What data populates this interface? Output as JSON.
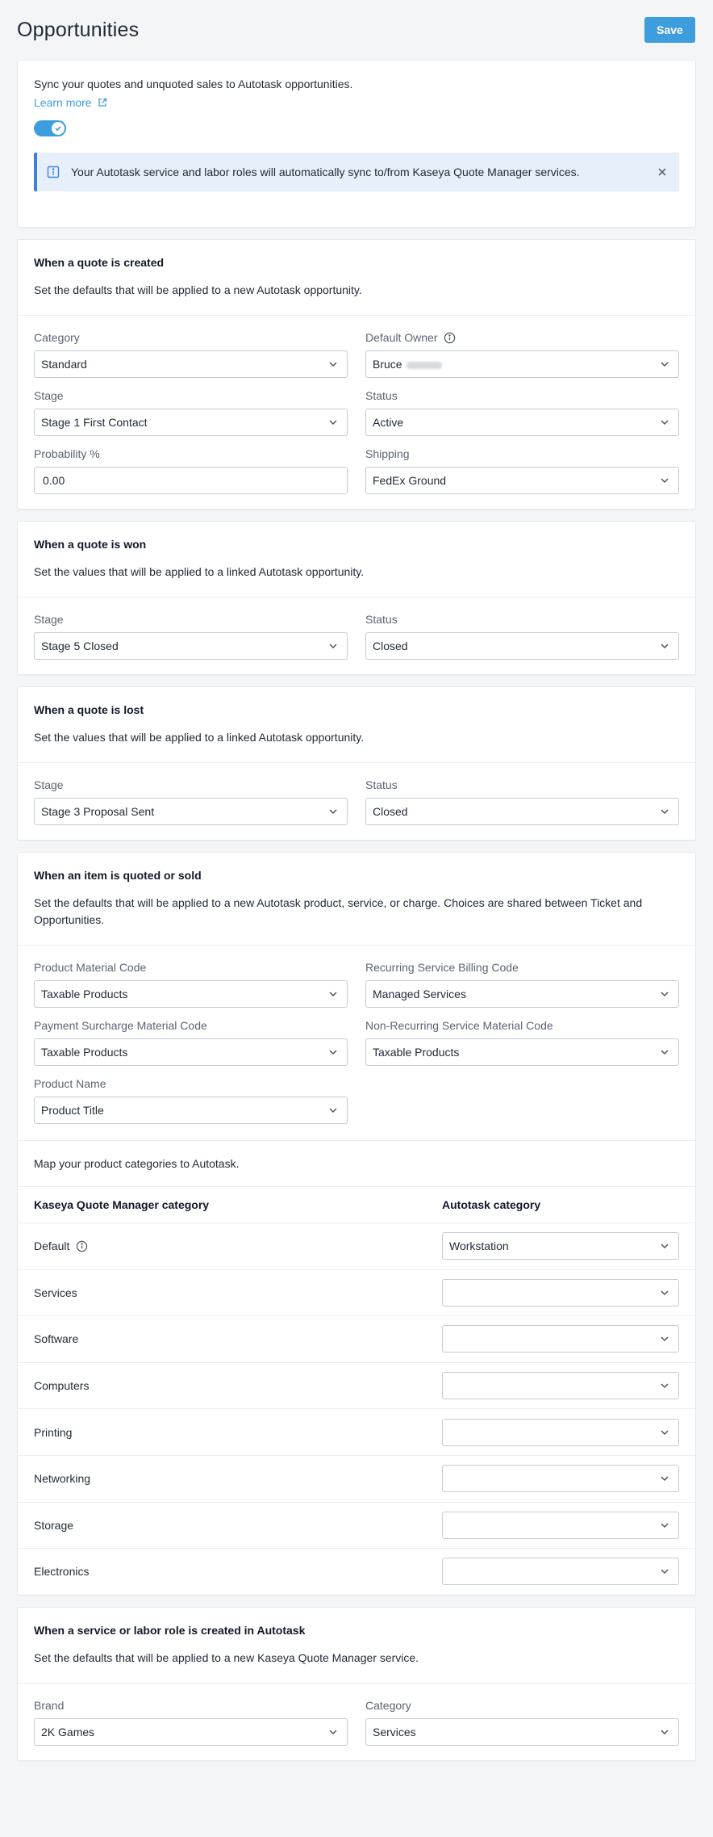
{
  "header": {
    "title": "Opportunities",
    "save_label": "Save"
  },
  "intro": {
    "description": "Sync your quotes and unquoted sales to Autotask opportunities.",
    "learn_more": "Learn more",
    "sync_enabled": true,
    "banner_text": "Your Autotask service and labor roles will automatically sync to/from Kaseya Quote Manager services."
  },
  "created": {
    "title": "When a quote is created",
    "subtitle": "Set the defaults that will be applied to a new Autotask opportunity.",
    "category_label": "Category",
    "category_value": "Standard",
    "owner_label": "Default Owner",
    "owner_value": "Bruce",
    "stage_label": "Stage",
    "stage_value": "Stage 1 First Contact",
    "status_label": "Status",
    "status_value": "Active",
    "probability_label": "Probability %",
    "probability_value": "0.00",
    "shipping_label": "Shipping",
    "shipping_value": "FedEx Ground"
  },
  "won": {
    "title": "When a quote is won",
    "subtitle": "Set the values that will be applied to a linked Autotask opportunity.",
    "stage_label": "Stage",
    "stage_value": "Stage 5 Closed",
    "status_label": "Status",
    "status_value": "Closed"
  },
  "lost": {
    "title": "When a quote is lost",
    "subtitle": "Set the values that will be applied to a linked Autotask opportunity.",
    "stage_label": "Stage",
    "stage_value": "Stage 3 Proposal Sent",
    "status_label": "Status",
    "status_value": "Closed"
  },
  "item": {
    "title": "When an item is quoted or sold",
    "subtitle": "Set the defaults that will be applied to a new Autotask product, service, or charge. Choices are shared between Ticket and Opportunities.",
    "product_material_label": "Product Material Code",
    "product_material_value": "Taxable Products",
    "recurring_billing_label": "Recurring Service Billing Code",
    "recurring_billing_value": "Managed Services",
    "surcharge_label": "Payment Surcharge Material Code",
    "surcharge_value": "Taxable Products",
    "nonrecurring_label": "Non-Recurring Service Material Code",
    "nonrecurring_value": "Taxable Products",
    "product_name_label": "Product Name",
    "product_name_value": "Product Title",
    "map_intro": "Map your product categories to Autotask.",
    "col_left": "Kaseya Quote Manager category",
    "col_right": "Autotask category",
    "rows": [
      {
        "name": "Default",
        "value": "Workstation"
      },
      {
        "name": "Services",
        "value": ""
      },
      {
        "name": "Software",
        "value": ""
      },
      {
        "name": "Computers",
        "value": ""
      },
      {
        "name": "Printing",
        "value": ""
      },
      {
        "name": "Networking",
        "value": ""
      },
      {
        "name": "Storage",
        "value": ""
      },
      {
        "name": "Electronics",
        "value": ""
      }
    ]
  },
  "service": {
    "title": "When a service or labor role is created in Autotask",
    "subtitle": "Set the defaults that will be applied to a new Kaseya Quote Manager service.",
    "brand_label": "Brand",
    "brand_value": "2K Games",
    "category_label": "Category",
    "category_value": "Services"
  },
  "colors": {
    "accent": "#3e9ddd",
    "banner_bg": "#e7f0fa",
    "banner_border": "#3e7ee0"
  }
}
